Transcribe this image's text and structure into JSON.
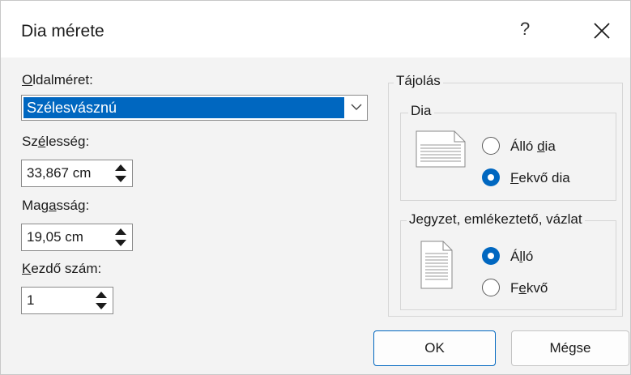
{
  "dialog": {
    "title": "Dia mérete",
    "help_label": "?",
    "close_icon": "close-icon"
  },
  "slide_size": {
    "label_first": "O",
    "label_rest": "ldalméret:",
    "selected_value": "Szélesvásznú"
  },
  "width": {
    "label_a": "Sz",
    "label_u": "é",
    "label_b": "lesség:",
    "value": "33,867 cm"
  },
  "height": {
    "label_a": "Mag",
    "label_u": "a",
    "label_b": "sság:",
    "value": "19,05 cm"
  },
  "start_number": {
    "label_u": "K",
    "label_b": "ezdő szám:",
    "value": "1"
  },
  "orientation": {
    "title": "Tájolás",
    "slides": {
      "title": "Dia",
      "portrait_a": "Álló ",
      "portrait_u": "d",
      "portrait_b": "ia",
      "landscape_u": "F",
      "landscape_b": "ekvő dia",
      "selected": "landscape"
    },
    "notes": {
      "title": "Jegyzet, emlékeztető, vázlat",
      "portrait_a": "Á",
      "portrait_u": "l",
      "portrait_b": "ló",
      "landscape_a": "F",
      "landscape_u": "e",
      "landscape_b": "kvő",
      "selected": "portrait"
    }
  },
  "buttons": {
    "ok": "OK",
    "cancel": "Mégse"
  },
  "colors": {
    "accent": "#0067c0",
    "dialog_bg": "#f3f3f3"
  }
}
